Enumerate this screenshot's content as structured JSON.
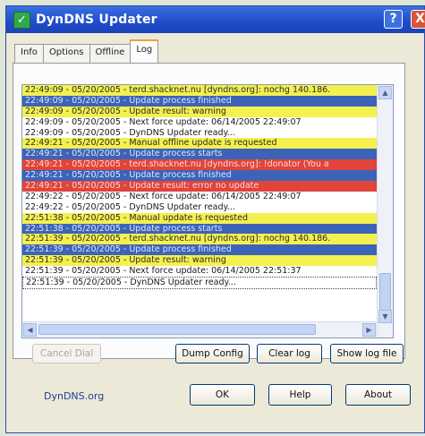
{
  "window": {
    "title": "DynDNS Updater",
    "help_glyph": "?",
    "close_glyph": "X"
  },
  "tabs": [
    {
      "label": "Info"
    },
    {
      "label": "Options"
    },
    {
      "label": "Offline"
    },
    {
      "label": "Log",
      "active": true
    }
  ],
  "log": {
    "lines": [
      {
        "text": "22:49:09 - 05/20/2005 - terd.shacknet.nu [dyndns.org]: nochg 140.186.",
        "kind": "yellow"
      },
      {
        "text": "22:49:09 - 05/20/2005 - Update process finished",
        "kind": "blue"
      },
      {
        "text": "22:49:09 - 05/20/2005 - Update result: warning",
        "kind": "yellow"
      },
      {
        "text": "22:49:09 - 05/20/2005 - Next force update: 06/14/2005 22:49:07",
        "kind": "white"
      },
      {
        "text": "22:49:09 - 05/20/2005 - DynDNS Updater ready...",
        "kind": "white"
      },
      {
        "text": "22:49:21 - 05/20/2005 - Manual offline update is requested",
        "kind": "yellow"
      },
      {
        "text": "22:49:21 - 05/20/2005 - Update process starts",
        "kind": "blue"
      },
      {
        "text": "22:49:21 - 05/20/2005 - terd.shacknet.nu [dyndns.org]: !donator (You a",
        "kind": "red"
      },
      {
        "text": "22:49:21 - 05/20/2005 - Update process finished",
        "kind": "blue"
      },
      {
        "text": "22:49:21 - 05/20/2005 - Update result: error no update",
        "kind": "red"
      },
      {
        "text": "22:49:22 - 05/20/2005 - Next force update: 06/14/2005 22:49:07",
        "kind": "white"
      },
      {
        "text": "22:49:22 - 05/20/2005 - DynDNS Updater ready...",
        "kind": "white"
      },
      {
        "text": "22:51:38 - 05/20/2005 - Manual update is requested",
        "kind": "yellow"
      },
      {
        "text": "22:51:38 - 05/20/2005 - Update process starts",
        "kind": "blue"
      },
      {
        "text": "22:51:39 - 05/20/2005 - terd.shacknet.nu [dyndns.org]: nochg 140.186.",
        "kind": "yellow"
      },
      {
        "text": "22:51:39 - 05/20/2005 - Update process finished",
        "kind": "blue"
      },
      {
        "text": "22:51:39 - 05/20/2005 - Update result: warning",
        "kind": "yellow"
      },
      {
        "text": "22:51:39 - 05/20/2005 - Next force update: 06/14/2005 22:51:37",
        "kind": "white"
      },
      {
        "text": "22:51:39 - 05/20/2005 - DynDNS Updater ready...",
        "kind": "white",
        "selected": true
      }
    ],
    "colors": {
      "yellow": "#f4f04f",
      "blue": "#3c63b7",
      "red": "#e0443b",
      "white": "#ffffff"
    }
  },
  "log_buttons": {
    "cancel_dial": "Cancel Dial",
    "dump_config": "Dump Config",
    "clear_log": "Clear log",
    "show_log_file": "Show log file"
  },
  "footer": {
    "link": "DynDNS.org",
    "ok": "OK",
    "help": "Help",
    "about": "About"
  },
  "icons": {
    "app": "dyndns-check-icon",
    "scroll_up": "▲",
    "scroll_down": "▼",
    "scroll_left": "◀",
    "scroll_right": "▶"
  }
}
